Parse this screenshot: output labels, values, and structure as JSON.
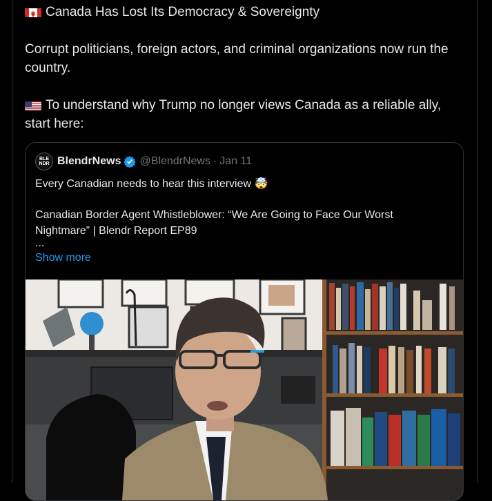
{
  "post": {
    "line1": "Canada Has Lost Its Democracy & Sovereignty",
    "line2": "Corrupt politicians, foreign actors, and criminal organizations now run the country.",
    "line3": "To understand why Trump no longer views Canada as a reliable ally, start here:"
  },
  "quote": {
    "avatar_text": "BLE NDR",
    "name": "BlendrNews",
    "handle": "@BlendrNews",
    "separator": "·",
    "date": "Jan 11",
    "text1": "Every Canadian needs to hear this interview 🤯",
    "text2": "Canadian Border Agent Whistleblower: “We Are Going to Face Our Worst Nightmare” | Blendr Report EP89",
    "ellipsis": "...",
    "show_more": "Show more"
  },
  "icons": {
    "canada_flag": "canada-flag-icon",
    "us_flag": "us-flag-icon",
    "verified": "verified-badge-icon"
  },
  "colors": {
    "background": "#000000",
    "text": "#e7e9ea",
    "muted": "#71767b",
    "link": "#1d9bf0",
    "border": "#2f3336"
  }
}
